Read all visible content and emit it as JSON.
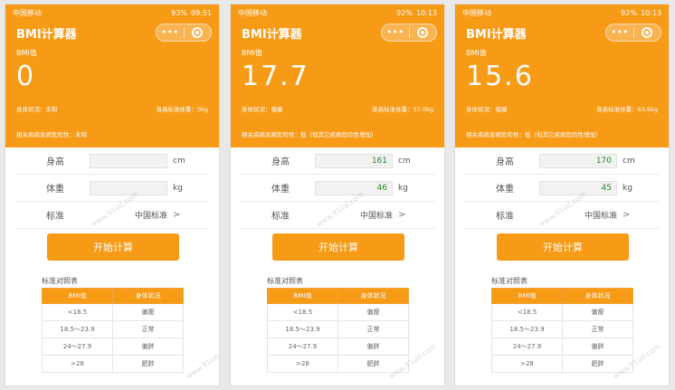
{
  "app_title": "BMI计算器",
  "capsule": {
    "more": "•••"
  },
  "labels": {
    "bmi": "BMI值",
    "body_status_prefix": "身体状况：",
    "standard_weight_prefix": "身高标准体重：",
    "risk_prefix": "相关疾病发病危险性：",
    "height": "身高",
    "weight": "体重",
    "standard": "标准",
    "start_button": "开始计算",
    "table_title": "标准对照表",
    "height_unit": "cm",
    "weight_unit": "kg",
    "chevron": ">"
  },
  "table": {
    "headers": [
      "BMI值",
      "身体状况"
    ],
    "rows": [
      [
        "<18.5",
        "偏瘦"
      ],
      [
        "18.5～23.9",
        "正常"
      ],
      [
        "24～27.9",
        "偏胖"
      ],
      [
        ">28",
        "肥胖"
      ]
    ]
  },
  "watermark": "www.91ud.com",
  "screens": [
    {
      "status": {
        "carrier": "中国移动",
        "battery": "93%",
        "time": "09:51"
      },
      "bmi": "0",
      "body_status": "未知",
      "standard_weight": "0kg",
      "risk": "未知",
      "height": "",
      "weight": "",
      "standard_value": "中国标准"
    },
    {
      "status": {
        "carrier": "中国移动",
        "battery": "92%",
        "time": "10:13"
      },
      "bmi": "17.7",
      "body_status": "偏瘦",
      "standard_weight": "57.0kg",
      "risk": "低（但其它疾病危险性增加）",
      "height": "161",
      "weight": "46",
      "standard_value": "中国标准"
    },
    {
      "status": {
        "carrier": "中国移动",
        "battery": "92%",
        "time": "10:13"
      },
      "bmi": "15.6",
      "body_status": "偏瘦",
      "standard_weight": "63.6kg",
      "risk": "低（但其它疾病危险性增加）",
      "height": "170",
      "weight": "45",
      "standard_value": "中国标准"
    }
  ]
}
